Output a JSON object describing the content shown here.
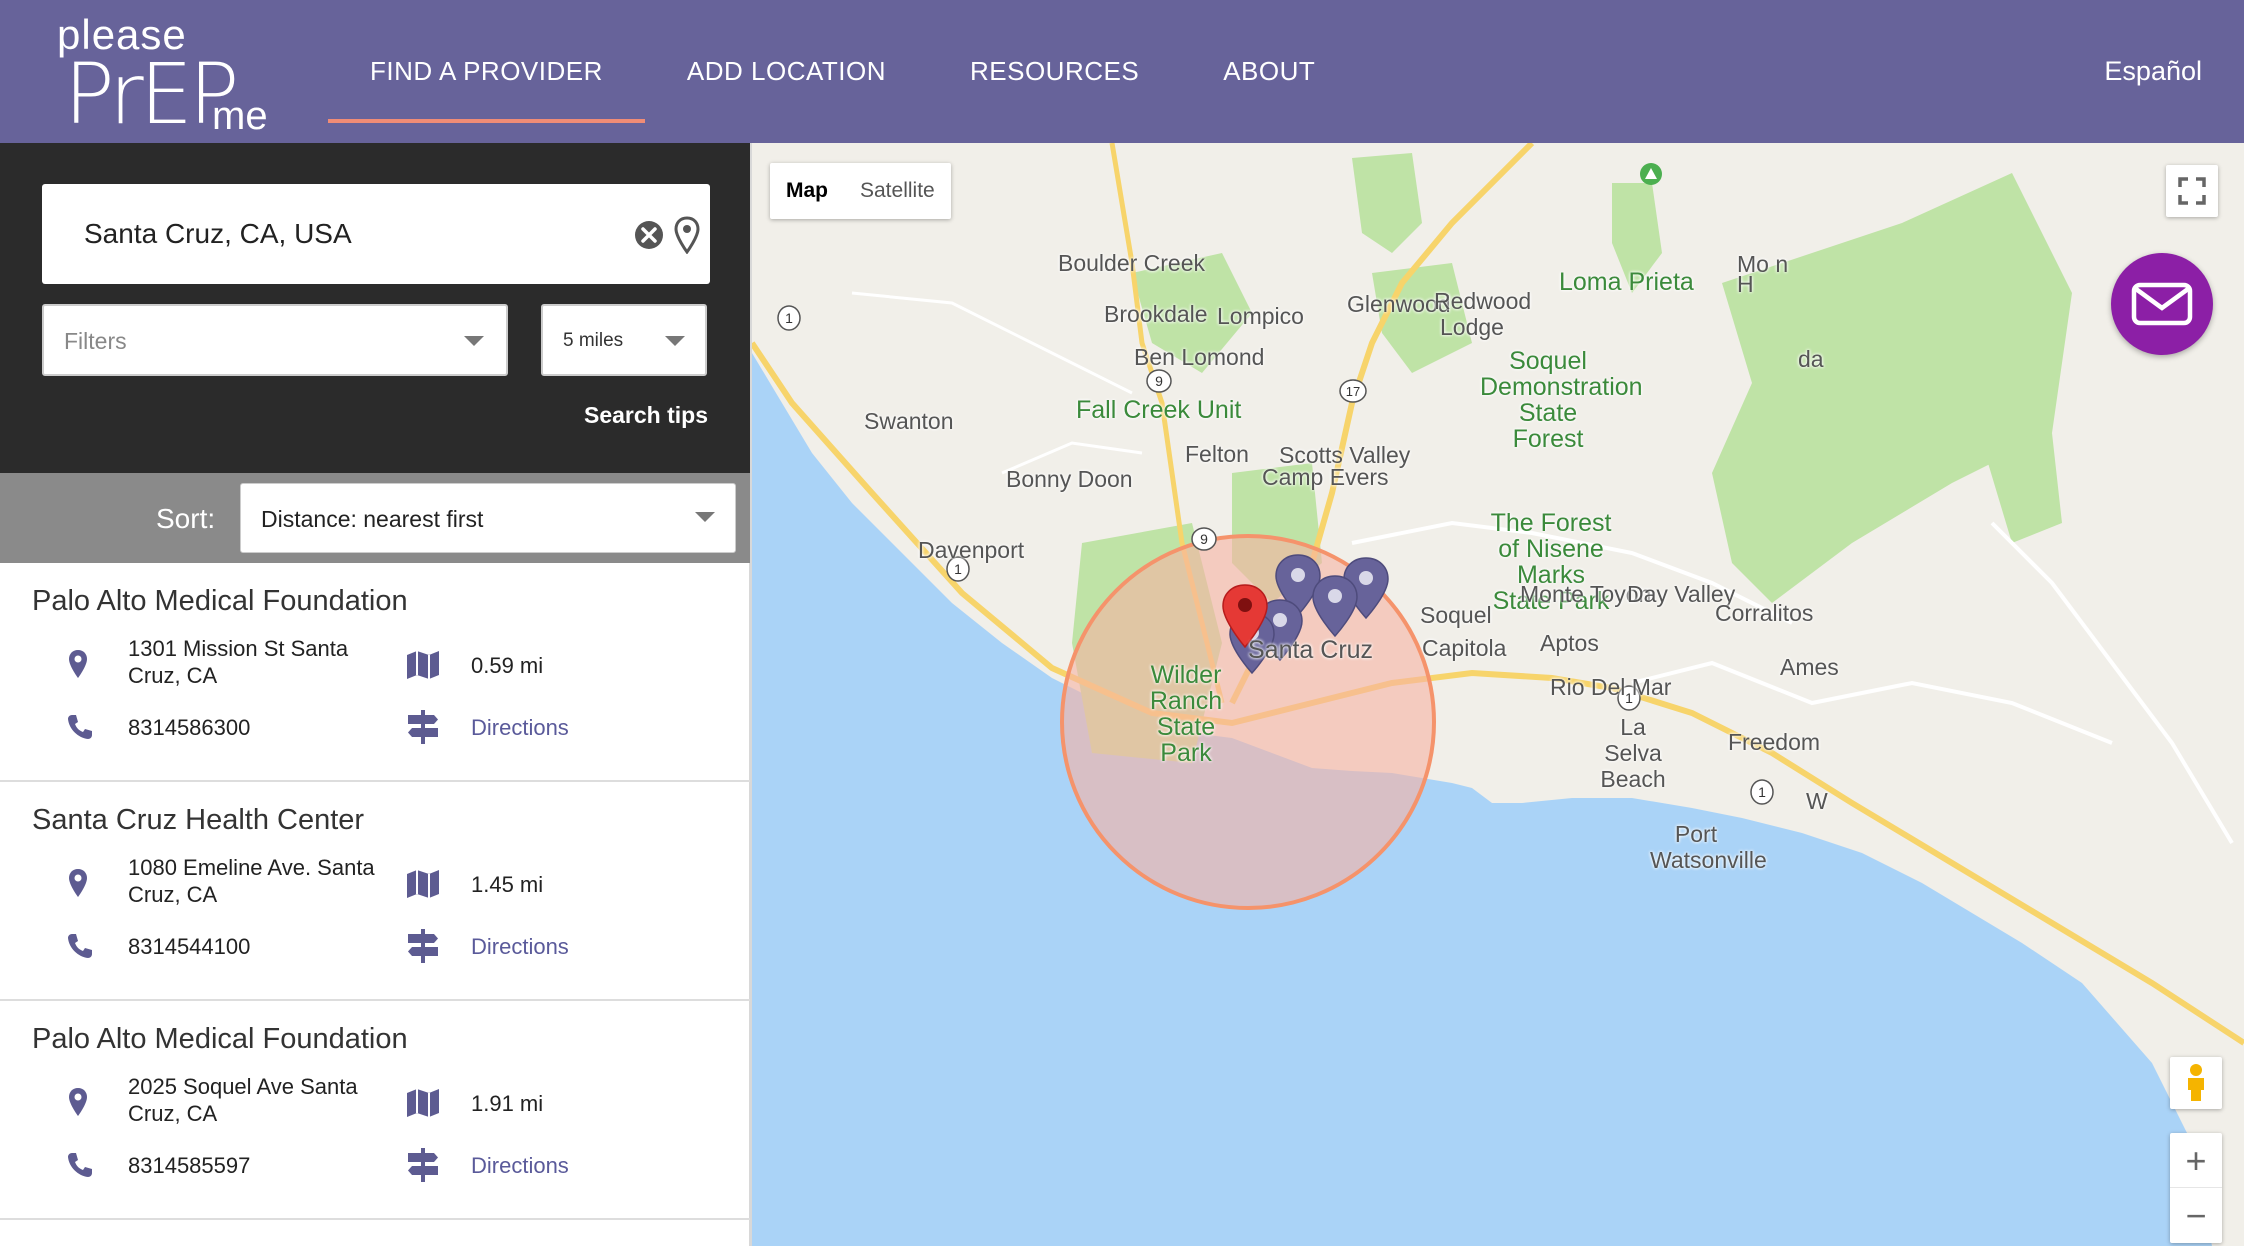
{
  "header": {
    "logo": {
      "please": "please",
      "prep": "PrEP",
      "me": "me"
    },
    "nav": [
      {
        "label": "FIND A PROVIDER",
        "active": true
      },
      {
        "label": "ADD LOCATION",
        "active": false
      },
      {
        "label": "RESOURCES",
        "active": false
      },
      {
        "label": "ABOUT",
        "active": false
      }
    ],
    "language": "Español"
  },
  "search": {
    "value": "Santa Cruz, CA, USA",
    "filters_placeholder": "Filters",
    "radius": "5 miles",
    "tips": "Search tips"
  },
  "sort": {
    "label": "Sort:",
    "value": "Distance: nearest first"
  },
  "results": [
    {
      "name": "Palo Alto Medical Foundation",
      "address": "1301 Mission St Santa Cruz, CA",
      "distance": "0.59 mi",
      "phone": "8314586300",
      "directions": "Directions"
    },
    {
      "name": "Santa Cruz Health Center",
      "address": "1080 Emeline Ave. Santa Cruz, CA",
      "distance": "1.45 mi",
      "phone": "8314544100",
      "directions": "Directions"
    },
    {
      "name": "Palo Alto Medical Foundation",
      "address": "2025 Soquel Ave Santa Cruz, CA",
      "distance": "1.91 mi",
      "phone": "8314585597",
      "directions": "Directions"
    }
  ],
  "map": {
    "type_map": "Map",
    "type_satellite": "Satellite",
    "zoom_in": "+",
    "zoom_out": "−",
    "places": {
      "boulder_creek": "Boulder Creek",
      "brookdale": "Brookdale",
      "lompico": "Lompico",
      "glenwood": "Glenwood",
      "redwood_lodge": "Redwood Lodge",
      "loma_prieta": "Loma Prieta",
      "mo_h": "Mo  n H",
      "ben_lomond": "Ben Lomond",
      "soquel_demo": "Soquel Demonstration State Forest",
      "swanton": "Swanton",
      "fall_creek": "Fall Creek Unit",
      "felton": "Felton",
      "scotts_valley": "Scotts Valley",
      "camp_evers": "Camp Evers",
      "bonny_doon": "Bonny Doon",
      "davenport": "Davenport",
      "forest_nisene": "The Forest of Nisene Marks State Park",
      "monte_toyon": "Monte Toyon",
      "day_valley": "Day Valley",
      "corralitos": "Corralitos",
      "soquel": "Soquel",
      "capitola": "Capitola",
      "aptos": "Aptos",
      "santa_cruz": "Santa Cruz",
      "wilder_ranch": "Wilder Ranch State Park",
      "rio_del_mar": "Rio Del Mar",
      "ames": "Ames",
      "la_selva": "La Selva Beach",
      "freedom": "Freedom",
      "port_watsonville": "Port Watsonville",
      "w": "W",
      "da": "da"
    },
    "shields": {
      "hwy1": "1",
      "hwy9": "9",
      "hwy17": "17"
    },
    "colors": {
      "water": "#aad3f7",
      "land": "#f1efe9",
      "park": "#bfe3a6",
      "radius_fill": "#f7b3a3",
      "radius_stroke": "#f5936b",
      "marker": "#67639a",
      "center_marker": "#e53935"
    }
  }
}
